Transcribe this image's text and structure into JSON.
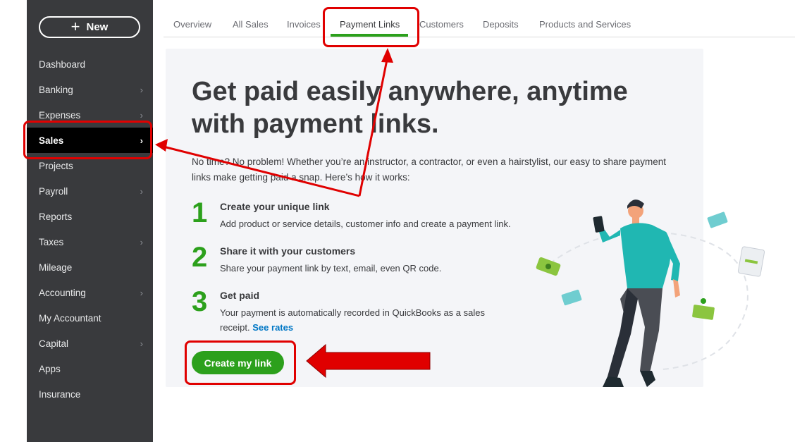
{
  "sidebar": {
    "new_button": "New",
    "items": [
      {
        "label": "Dashboard",
        "chevron": false
      },
      {
        "label": "Banking",
        "chevron": true
      },
      {
        "label": "Expenses",
        "chevron": true
      },
      {
        "label": "Sales",
        "chevron": true,
        "active": true
      },
      {
        "label": "Projects",
        "chevron": false
      },
      {
        "label": "Payroll",
        "chevron": true
      },
      {
        "label": "Reports",
        "chevron": false
      },
      {
        "label": "Taxes",
        "chevron": true
      },
      {
        "label": "Mileage",
        "chevron": false
      },
      {
        "label": "Accounting",
        "chevron": true
      },
      {
        "label": "My Accountant",
        "chevron": false
      },
      {
        "label": "Capital",
        "chevron": true
      },
      {
        "label": "Apps",
        "chevron": false
      },
      {
        "label": "Insurance",
        "chevron": false
      }
    ]
  },
  "tabs": [
    "Overview",
    "All Sales",
    "Invoices",
    "Payment Links",
    "Customers",
    "Deposits",
    "Products and Services"
  ],
  "active_tab": "Payment Links",
  "main": {
    "headline": "Get paid easily anywhere, anytime with payment links.",
    "intro": "No time? No problem! Whether you’re an instructor, a contractor, or even a hairstylist, our easy to share payment links make getting paid a snap. Here’s how it works:",
    "steps": [
      {
        "num": "1",
        "title": "Create your unique link",
        "desc": "Add product or service details, customer info and create a payment link."
      },
      {
        "num": "2",
        "title": "Share it with your customers",
        "desc": "Share your payment link by text, email, even QR code."
      },
      {
        "num": "3",
        "title": "Get paid",
        "desc": "Your payment is automatically recorded in QuickBooks as a sales receipt.",
        "link": "See rates"
      }
    ],
    "cta_label": "Create my link"
  },
  "colors": {
    "accent_green": "#2ca01c",
    "sidebar_bg": "#393a3d",
    "annotation_red": "#e00000",
    "link_blue": "#0077c5"
  }
}
